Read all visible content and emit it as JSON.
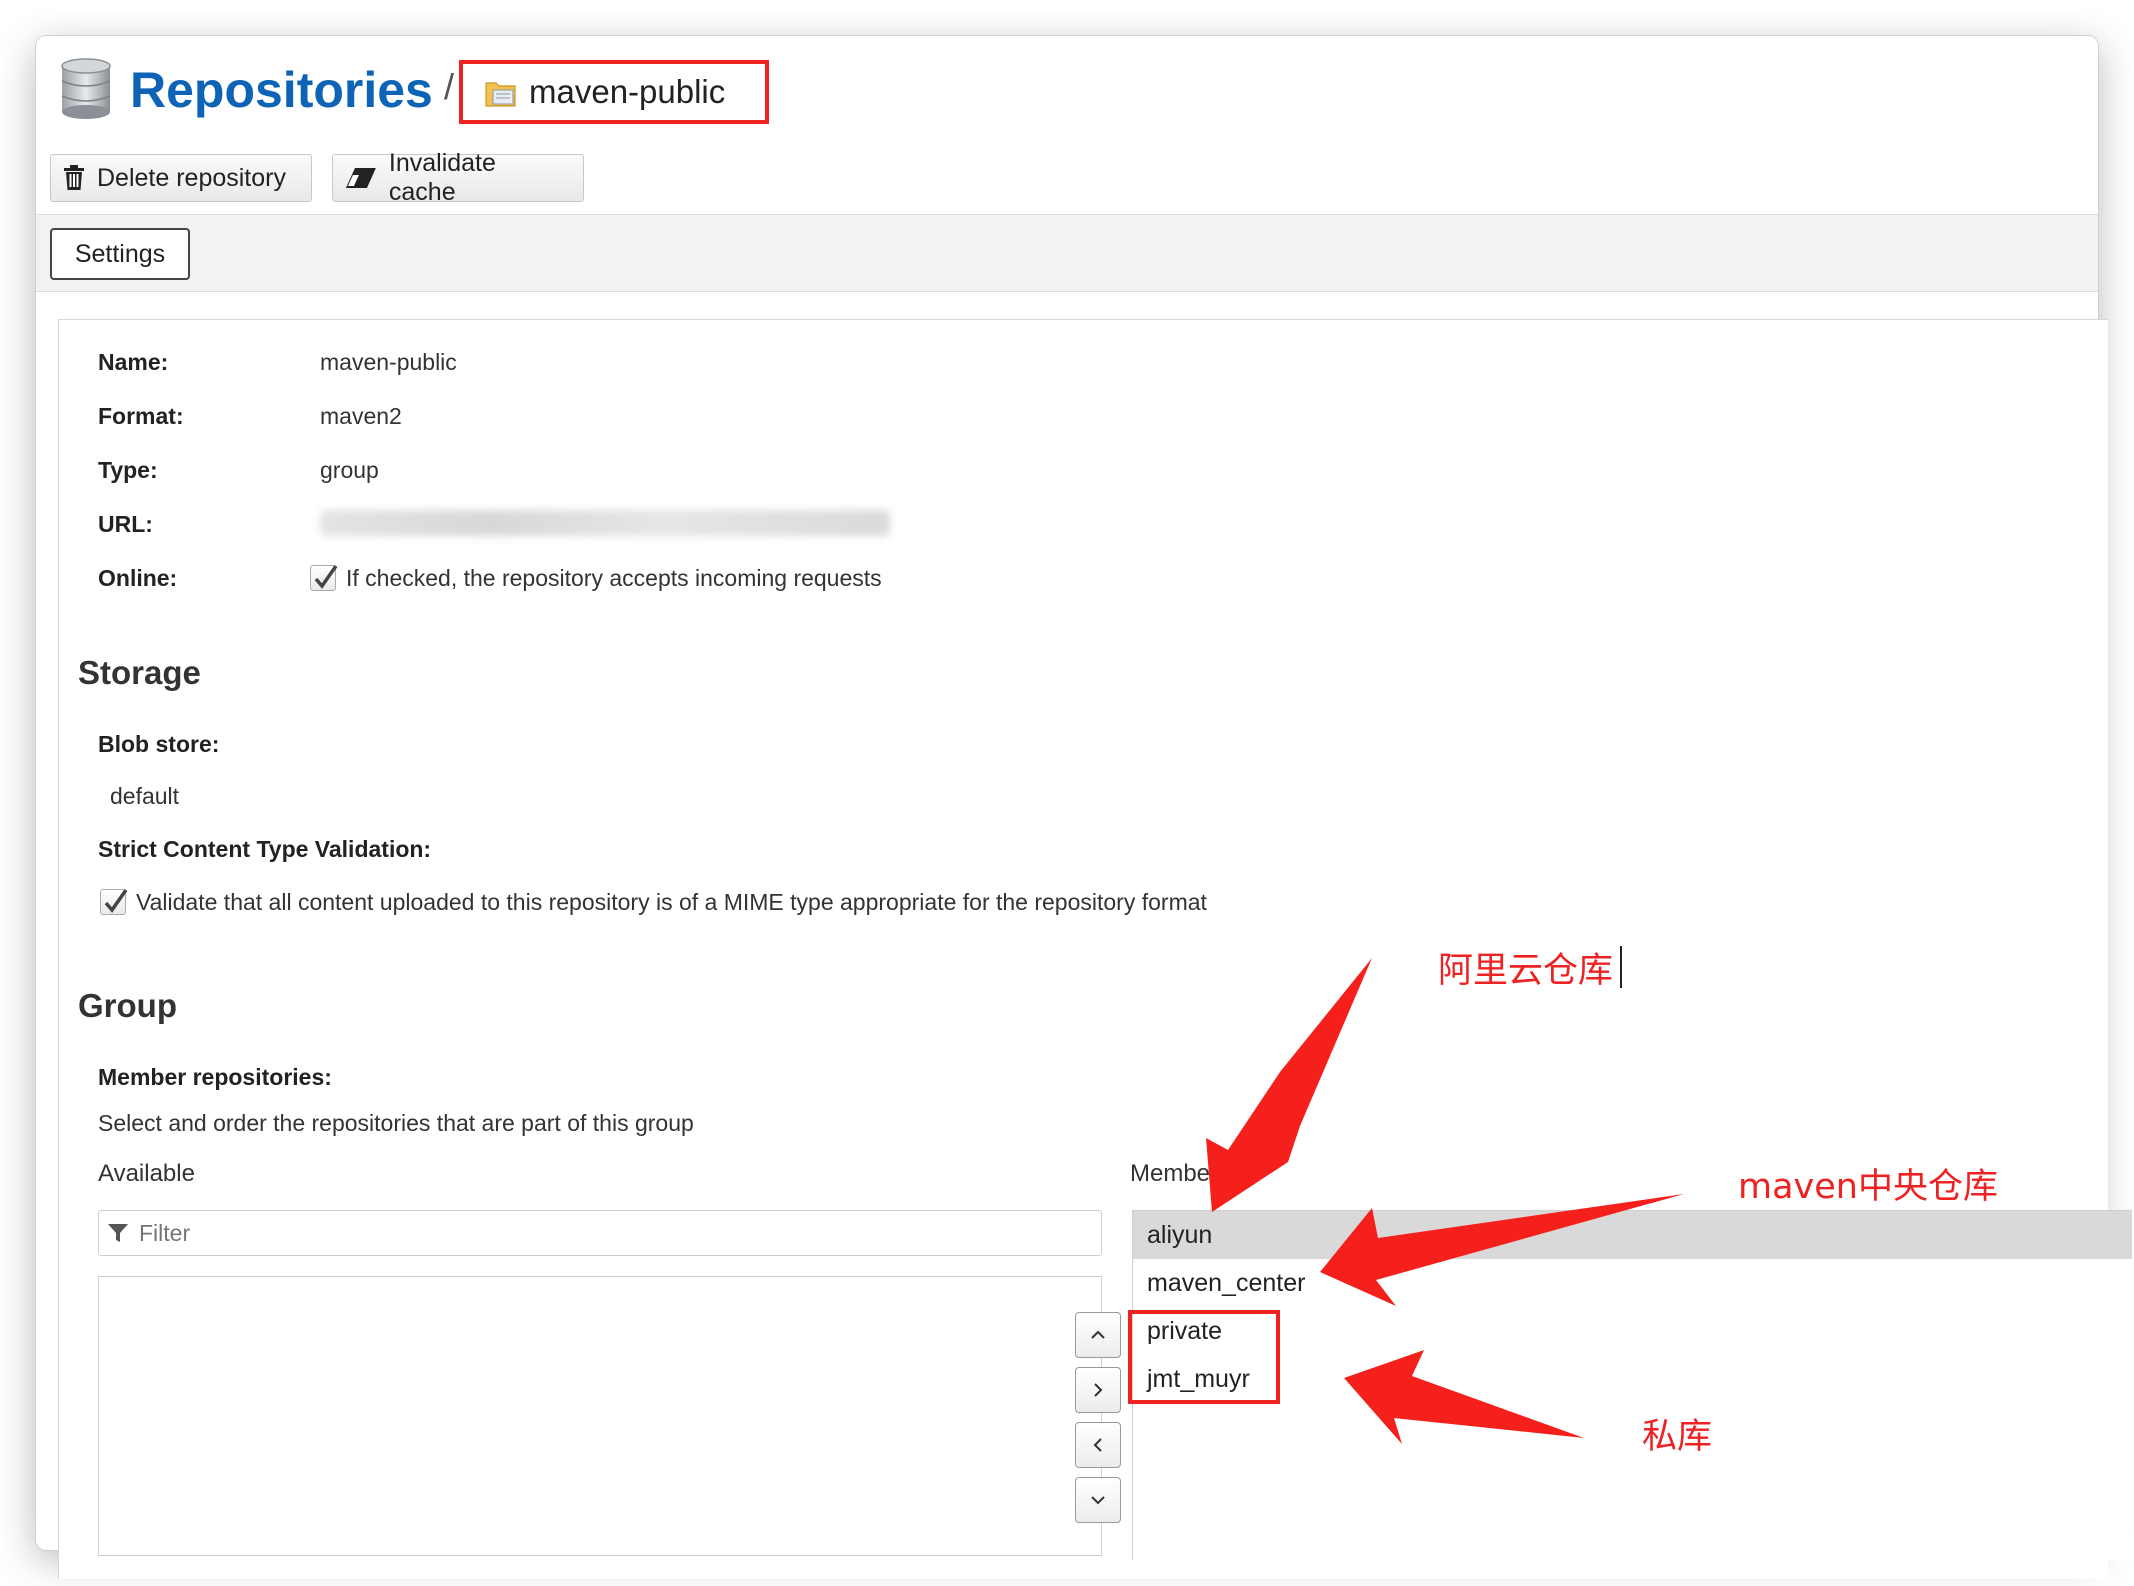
{
  "header": {
    "title": "Repositories",
    "separator": "/",
    "current_repo": "maven-public",
    "delete_label": "Delete repository",
    "invalidate_label": "Invalidate cache"
  },
  "tabs": {
    "settings_label": "Settings"
  },
  "fields": {
    "name_label": "Name:",
    "name_value": "maven-public",
    "format_label": "Format:",
    "format_value": "maven2",
    "type_label": "Type:",
    "type_value": "group",
    "url_label": "URL:",
    "online_label": "Online:",
    "online_text": "If checked, the repository accepts incoming requests"
  },
  "storage": {
    "heading": "Storage",
    "blob_label": "Blob store:",
    "blob_value": "default",
    "strict_label": "Strict Content Type Validation:",
    "strict_text": "Validate that all content uploaded to this repository is of a MIME type appropriate for the repository format"
  },
  "group": {
    "heading": "Group",
    "member_label": "Member repositories:",
    "member_desc": "Select and order the repositories that are part of this group",
    "available_label": "Available",
    "members_label": "Membe",
    "filter_placeholder": "Filter",
    "members": [
      "aliyun",
      "maven_center",
      "private",
      "jmt_muyr"
    ]
  },
  "annotations": {
    "aliyun": "阿里云仓库",
    "central": "maven中央仓库",
    "private": "私库"
  },
  "colors": {
    "title_blue": "#0d63b6",
    "annotation_red": "#ee2222"
  }
}
